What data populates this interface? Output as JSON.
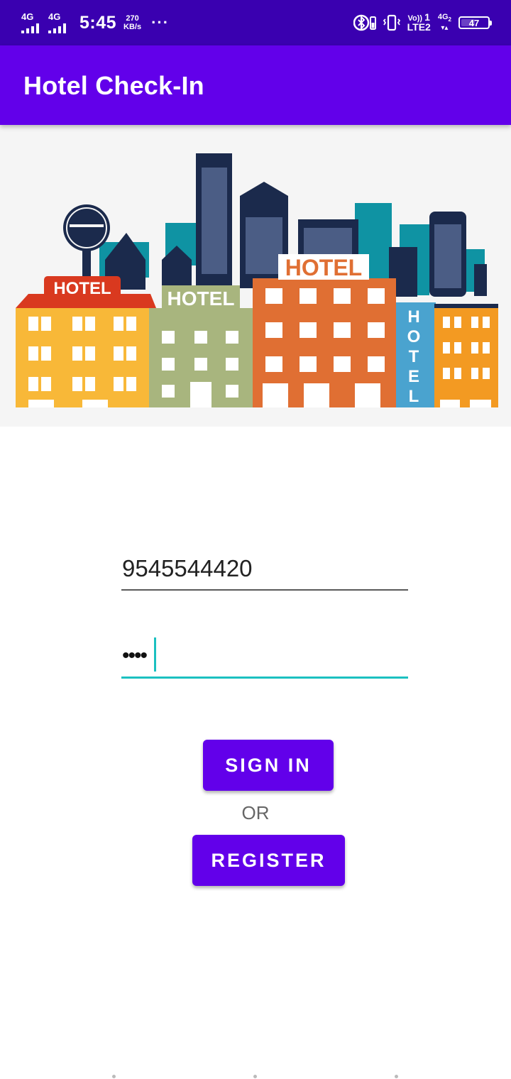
{
  "status_bar": {
    "net1_label": "4G",
    "net2_label": "4G",
    "time": "5:45",
    "speed_value": "270",
    "speed_unit": "KB/s",
    "more": "···",
    "volte_top": "Vo))",
    "volte_sim": "1",
    "volte_bottom": "LTE2",
    "net3_label": "4G",
    "net3_sub": "2",
    "battery_level": "47"
  },
  "app_bar": {
    "title": "Hotel Check-In"
  },
  "banner": {
    "sign_left": "HOTEL",
    "sign_middle": "HOTEL",
    "sign_center": "HOTEL",
    "sign_vertical": [
      "H",
      "O",
      "T",
      "E",
      "L"
    ]
  },
  "form": {
    "phone_value": "9545544420",
    "password_masked": "••••"
  },
  "buttons": {
    "sign_in": "SIGN IN",
    "or": "OR",
    "register": "REGISTER"
  },
  "colors": {
    "status_bar": "#3a00b0",
    "primary": "#6200ea",
    "accent": "#1bc0c0"
  }
}
